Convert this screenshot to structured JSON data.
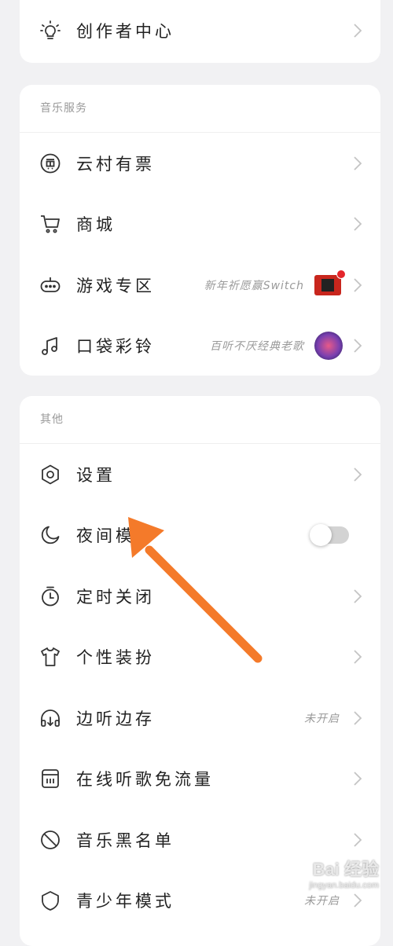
{
  "top_card": {
    "creator_center": "创作者中心"
  },
  "music_services": {
    "title": "音乐服务",
    "items": [
      {
        "label": "云村有票"
      },
      {
        "label": "商城"
      },
      {
        "label": "游戏专区",
        "sub": "新年祈愿赢Switch"
      },
      {
        "label": "口袋彩铃",
        "sub": "百听不厌经典老歌"
      }
    ]
  },
  "other": {
    "title": "其他",
    "items": [
      {
        "label": "设置"
      },
      {
        "label": "夜间模"
      },
      {
        "label": "定时关闭"
      },
      {
        "label": "个性装扮"
      },
      {
        "label": "边听边存",
        "sub": "未开启"
      },
      {
        "label": "在线听歌免流量"
      },
      {
        "label": "音乐黑名单"
      },
      {
        "label": "青少年模式",
        "sub": "未开启"
      }
    ]
  },
  "toggle": {
    "night_mode_on": false
  },
  "colors": {
    "background": "#f1f1f3",
    "card": "#ffffff",
    "arrow": "#f47a2a",
    "toggle_off": "#d3d3d3"
  },
  "watermark": {
    "main": "Bai 经验",
    "sub": "jingyan.baidu.com"
  }
}
